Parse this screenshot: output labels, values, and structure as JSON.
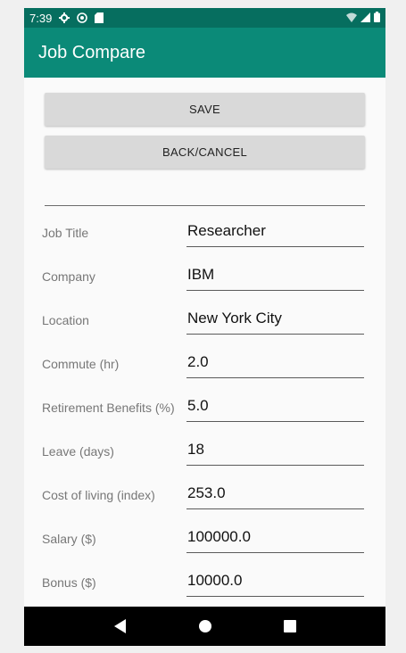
{
  "status_bar": {
    "time": "7:39",
    "icons": [
      "gear-icon",
      "at-icon",
      "sd-card-icon"
    ],
    "right_icons": [
      "wifi-icon",
      "signal-icon",
      "battery-icon"
    ]
  },
  "app_bar": {
    "title": "Job Compare",
    "color": "#0b8a78"
  },
  "buttons": {
    "save_label": "SAVE",
    "back_label": "BACK/CANCEL"
  },
  "form": {
    "fields": [
      {
        "label": "Job Title",
        "value": "Researcher"
      },
      {
        "label": "Company",
        "value": "IBM"
      },
      {
        "label": "Location",
        "value": "New York City"
      },
      {
        "label": "Commute (hr)",
        "value": "2.0"
      },
      {
        "label": "Retirement Benefits (%)",
        "value": "5.0"
      },
      {
        "label": "Leave (days)",
        "value": "18"
      },
      {
        "label": "Cost of living (index)",
        "value": "253.0"
      },
      {
        "label": "Salary ($)",
        "value": "100000.0"
      },
      {
        "label": "Bonus ($)",
        "value": "10000.0"
      }
    ]
  },
  "nav_bar": {
    "icons": [
      "back-icon",
      "home-icon",
      "recents-icon"
    ]
  }
}
